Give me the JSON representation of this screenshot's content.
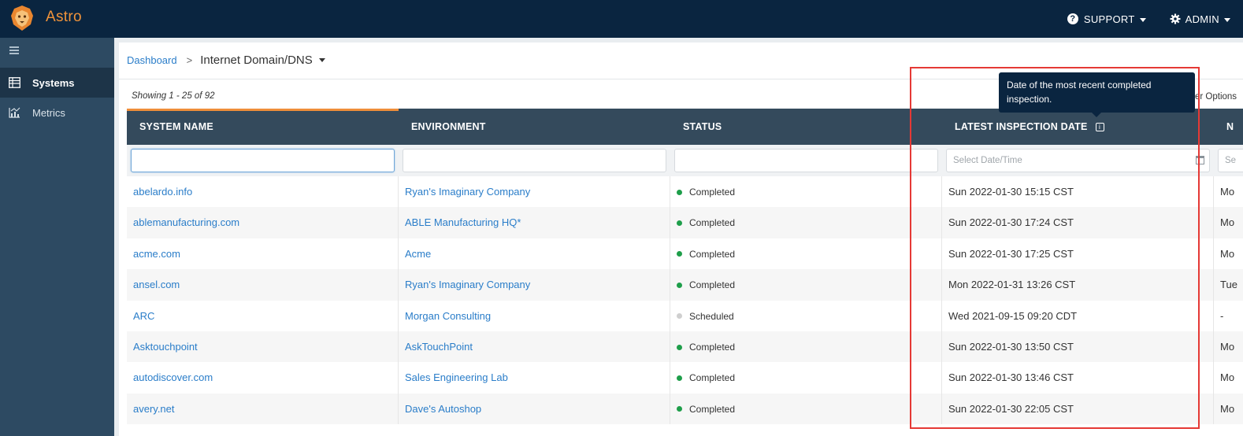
{
  "app": {
    "name": "Astro"
  },
  "topbar": {
    "support_label": "SUPPORT",
    "admin_label": "ADMIN",
    "support_icon": "question-circle-icon",
    "admin_icon": "gear-icon"
  },
  "sidebar": {
    "items": [
      {
        "label": "Systems",
        "icon": "table-icon",
        "active": true
      },
      {
        "label": "Metrics",
        "icon": "chart-icon",
        "active": false
      }
    ]
  },
  "breadcrumb": {
    "root": "Dashboard",
    "separator": ">",
    "current": "Internet Domain/DNS"
  },
  "listing": {
    "showing": "Showing 1 - 25 of 92",
    "options_label": "er Options"
  },
  "table": {
    "columns": [
      "SYSTEM NAME",
      "ENVIRONMENT",
      "STATUS",
      "LATEST INSPECTION DATE",
      "N"
    ],
    "date_filter_placeholder": "Select Date/Time",
    "next_filter_placeholder": "Se",
    "info_icon_label": "i",
    "rows": [
      {
        "name": "abelardo.info",
        "environment": "Ryan's Imaginary Company",
        "status": "Completed",
        "date": "Sun 2022-01-30 15:15 CST",
        "next": "Mo"
      },
      {
        "name": "ablemanufacturing.com",
        "environment": "ABLE Manufacturing HQ*",
        "status": "Completed",
        "date": "Sun 2022-01-30 17:24 CST",
        "next": "Mo"
      },
      {
        "name": "acme.com",
        "environment": "Acme",
        "status": "Completed",
        "date": "Sun 2022-01-30 17:25 CST",
        "next": "Mo"
      },
      {
        "name": "ansel.com",
        "environment": "Ryan's Imaginary Company",
        "status": "Completed",
        "date": "Mon 2022-01-31 13:26 CST",
        "next": "Tue"
      },
      {
        "name": "ARC",
        "environment": "Morgan Consulting",
        "status": "Scheduled",
        "date": "Wed 2021-09-15 09:20 CDT",
        "next": "-"
      },
      {
        "name": "Asktouchpoint",
        "environment": "AskTouchPoint",
        "status": "Completed",
        "date": "Sun 2022-01-30 13:50 CST",
        "next": "Mo"
      },
      {
        "name": "autodiscover.com",
        "environment": "Sales Engineering Lab",
        "status": "Completed",
        "date": "Sun 2022-01-30 13:46 CST",
        "next": "Mo"
      },
      {
        "name": "avery.net",
        "environment": "Dave's Autoshop",
        "status": "Completed",
        "date": "Sun 2022-01-30 22:05 CST",
        "next": "Mo"
      }
    ]
  },
  "tooltip": {
    "text": "Date of the most recent completed inspection."
  },
  "colors": {
    "topbar": "#0a2540",
    "brand": "#f0933a",
    "sidebar": "#2d4a62",
    "table_header": "#344a5c",
    "link": "#2a7dc9",
    "status_completed": "#1e9e4a",
    "status_scheduled": "#cfcfcf",
    "sort_indicator": "#ef8e3a",
    "highlight": "#e53935"
  }
}
